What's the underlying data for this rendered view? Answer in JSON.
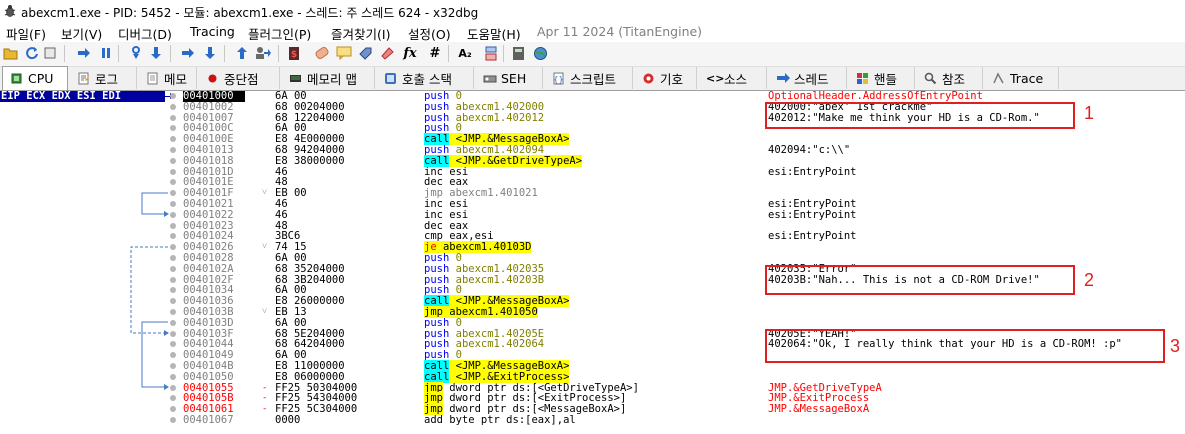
{
  "window": {
    "title": "abexcm1.exe - PID: 5452 - 모듈: abexcm1.exe - 스레드: 주 스레드 624 - x32dbg"
  },
  "menu": {
    "items": [
      "파일(F)",
      "보기(V)",
      "디버그(D)",
      "Tracing",
      "플러그인(P)",
      "즐겨찾기(I)",
      "설정(O)",
      "도움말(H)"
    ],
    "date_label": "Apr 11 2024 (TitanEngine)"
  },
  "toolbar": {
    "icons": [
      "open-icon",
      "restart-icon",
      "pause-icon",
      "run-icon",
      "run-pause-icon",
      "step-into-icon",
      "step-over-icon",
      "trace-into-icon",
      "trace-over-icon",
      "execute-till-return-icon",
      "run-to-user-code-icon",
      "patch-icon",
      "script-icon",
      "comment-icon",
      "label-icon",
      "bookmark-icon",
      "function-icon",
      "hash-icon",
      "text-size-icon",
      "calculator-icon",
      "memory-icon",
      "globe-icon"
    ],
    "text_glyphs": {
      "fx": "fx",
      "hash": "#",
      "font": "A₂"
    }
  },
  "tabs": [
    {
      "label": "CPU",
      "icon": "cpu-icon",
      "active": true
    },
    {
      "label": "로그",
      "icon": "log-icon",
      "active": false
    },
    {
      "label": "메모",
      "icon": "notes-icon",
      "active": false
    },
    {
      "label": "중단점",
      "icon": "breakpoint-icon",
      "active": false
    },
    {
      "label": "메모리 맵",
      "icon": "memory-map-icon",
      "active": false
    },
    {
      "label": "호출 스택",
      "icon": "call-stack-icon",
      "active": false
    },
    {
      "label": "SEH",
      "icon": "seh-icon",
      "active": false
    },
    {
      "label": "스크립트",
      "icon": "script-tab-icon",
      "active": false
    },
    {
      "label": "기호",
      "icon": "symbols-icon",
      "active": false
    },
    {
      "label": "소스",
      "icon": "source-icon",
      "active": false
    },
    {
      "label": "스레드",
      "icon": "threads-icon",
      "active": false
    },
    {
      "label": "핸들",
      "icon": "handles-icon",
      "active": false
    },
    {
      "label": "참조",
      "icon": "references-icon",
      "active": false
    },
    {
      "label": "Trace",
      "icon": "trace-icon",
      "active": false
    }
  ],
  "registers_label": "EIP ECX EDX ESI EDI",
  "disasm": [
    {
      "addr": "00401000",
      "bytes": "6A 00",
      "mnem": "push",
      "ops": "0",
      "cmt": "OptionalHeader.AddressOfEntryPoint",
      "addr_style": "cur",
      "cmt_style": "red"
    },
    {
      "addr": "00401002",
      "bytes": "68 00204000",
      "mnem": "push",
      "ops": "abexcm1.402000",
      "cmt": "402000:\"abex' 1st crackme\""
    },
    {
      "addr": "00401007",
      "bytes": "68 12204000",
      "mnem": "push",
      "ops": "abexcm1.402012",
      "cmt": "402012:\"Make me think your HD is a CD-Rom.\""
    },
    {
      "addr": "0040100C",
      "bytes": "6A 00",
      "mnem": "push",
      "ops": "0",
      "cmt": ""
    },
    {
      "addr": "0040100E",
      "bytes": "E8 4E000000",
      "mnem": "call",
      "ops": "<JMP.&MessageBoxA>",
      "cmt": ""
    },
    {
      "addr": "00401013",
      "bytes": "68 94204000",
      "mnem": "push",
      "ops": "abexcm1.402094",
      "cmt": "402094:\"c:\\\\\""
    },
    {
      "addr": "00401018",
      "bytes": "E8 38000000",
      "mnem": "call",
      "ops": "<JMP.&GetDriveTypeA>",
      "cmt": ""
    },
    {
      "addr": "0040101D",
      "bytes": "46",
      "mnem": "inc",
      "ops": "esi",
      "cmt": "esi:EntryPoint"
    },
    {
      "addr": "0040101E",
      "bytes": "48",
      "mnem": "dec",
      "ops": "eax",
      "cmt": ""
    },
    {
      "addr": "0040101F",
      "bytes": "EB 00",
      "mnem": "jmp",
      "ops": "abexcm1.401021",
      "cmt": "",
      "arrow": "v"
    },
    {
      "addr": "00401021",
      "bytes": "46",
      "mnem": "inc",
      "ops": "esi",
      "cmt": "esi:EntryPoint"
    },
    {
      "addr": "00401022",
      "bytes": "46",
      "mnem": "inc",
      "ops": "esi",
      "cmt": "esi:EntryPoint"
    },
    {
      "addr": "00401023",
      "bytes": "48",
      "mnem": "dec",
      "ops": "eax",
      "cmt": ""
    },
    {
      "addr": "00401024",
      "bytes": "3BC6",
      "mnem": "cmp",
      "ops": "eax,esi",
      "cmt": "esi:EntryPoint"
    },
    {
      "addr": "00401026",
      "bytes": "74 15",
      "mnem": "je",
      "ops": "abexcm1.40103D",
      "cmt": "",
      "arrow": "v"
    },
    {
      "addr": "00401028",
      "bytes": "6A 00",
      "mnem": "push",
      "ops": "0",
      "cmt": ""
    },
    {
      "addr": "0040102A",
      "bytes": "68 35204000",
      "mnem": "push",
      "ops": "abexcm1.402035",
      "cmt": "402035:\"Error\""
    },
    {
      "addr": "0040102F",
      "bytes": "68 3B204000",
      "mnem": "push",
      "ops": "abexcm1.40203B",
      "cmt": "40203B:\"Nah... This is not a CD-ROM Drive!\""
    },
    {
      "addr": "00401034",
      "bytes": "6A 00",
      "mnem": "push",
      "ops": "0",
      "cmt": ""
    },
    {
      "addr": "00401036",
      "bytes": "E8 26000000",
      "mnem": "call",
      "ops": "<JMP.&MessageBoxA>",
      "cmt": ""
    },
    {
      "addr": "0040103B",
      "bytes": "EB 13",
      "mnem": "jmp",
      "ops": "abexcm1.401050",
      "cmt": "",
      "arrow": "v"
    },
    {
      "addr": "0040103D",
      "bytes": "6A 00",
      "mnem": "push",
      "ops": "0",
      "cmt": ""
    },
    {
      "addr": "0040103F",
      "bytes": "68 5E204000",
      "mnem": "push",
      "ops": "abexcm1.40205E",
      "cmt": "40205E:\"YEAH!\""
    },
    {
      "addr": "00401044",
      "bytes": "68 64204000",
      "mnem": "push",
      "ops": "abexcm1.402064",
      "cmt": "402064:\"Ok, I really think that your HD is a CD-ROM! :p\""
    },
    {
      "addr": "00401049",
      "bytes": "6A 00",
      "mnem": "push",
      "ops": "0",
      "cmt": ""
    },
    {
      "addr": "0040104B",
      "bytes": "E8 11000000",
      "mnem": "call",
      "ops": "<JMP.&MessageBoxA>",
      "cmt": ""
    },
    {
      "addr": "00401050",
      "bytes": "E8 06000000",
      "mnem": "call",
      "ops": "<JMP.&ExitProcess>",
      "cmt": ""
    },
    {
      "addr": "00401055",
      "bytes": "FF25 50304000",
      "mnem": "jmp",
      "ops": "dword ptr ds:[<GetDriveTypeA>]",
      "cmt": "JMP.&GetDriveTypeA",
      "addr_style": "red",
      "cmt_style": "red",
      "arrow": "-"
    },
    {
      "addr": "0040105B",
      "bytes": "FF25 54304000",
      "mnem": "jmp",
      "ops": "dword ptr ds:[<ExitProcess>]",
      "cmt": "JMP.&ExitProcess",
      "addr_style": "red",
      "cmt_style": "red",
      "arrow": "-"
    },
    {
      "addr": "00401061",
      "bytes": "FF25 5C304000",
      "mnem": "jmp",
      "ops": "dword ptr ds:[<MessageBoxA>]",
      "cmt": "JMP.&MessageBoxA",
      "addr_style": "red",
      "cmt_style": "red",
      "arrow": "-"
    },
    {
      "addr": "00401067",
      "bytes": "0000",
      "mnem": "add",
      "ops": "byte ptr ds:[eax],al",
      "cmt": ""
    }
  ],
  "annotations": [
    {
      "label": "1"
    },
    {
      "label": "2"
    },
    {
      "label": "3"
    }
  ],
  "colors": {
    "accent_blue": "#0000a0",
    "call_highlight": "#00ffff",
    "jmp_highlight": "#ffff00",
    "annotation_red": "#e02020"
  }
}
